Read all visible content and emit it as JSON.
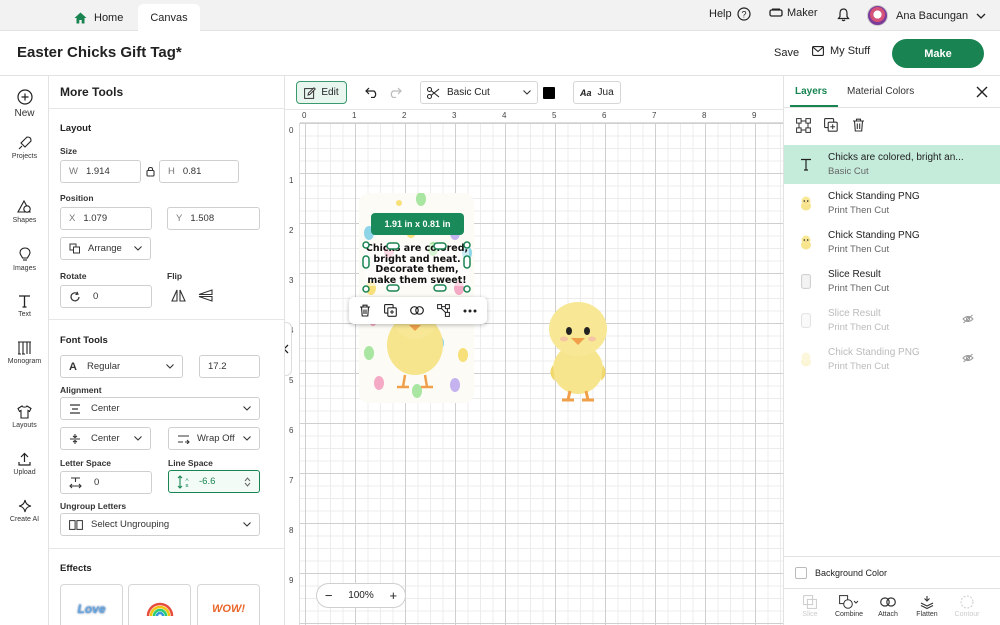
{
  "topbar": {
    "home_label": "Home",
    "canvas_label": "Canvas",
    "help_label": "Help",
    "maker_label": "Maker",
    "user_name": "Ana Bacungan"
  },
  "titlebar": {
    "project_title": "Easter Chicks Gift Tag*",
    "save_label": "Save",
    "mystuff_label": "My Stuff",
    "make_label": "Make"
  },
  "rail": {
    "new": "New",
    "projects": "Projects",
    "shapes": "Shapes",
    "images": "Images",
    "text": "Text",
    "monogram": "Monogram",
    "layouts": "Layouts",
    "upload": "Upload",
    "create_ai": "Create AI"
  },
  "tools": {
    "header": "More Tools",
    "layout": "Layout",
    "size": "Size",
    "w_prefix": "W",
    "w_value": "1.914",
    "h_prefix": "H",
    "h_value": "0.81",
    "position": "Position",
    "x_prefix": "X",
    "x_value": "1.079",
    "y_prefix": "Y",
    "y_value": "1.508",
    "arrange": "Arrange",
    "rotate": "Rotate",
    "rotate_value": "0",
    "flip": "Flip",
    "font_tools": "Font Tools",
    "font_style": "Regular",
    "font_size": "17.2",
    "alignment": "Alignment",
    "align_value": "Center",
    "valign_value": "Center",
    "wrap_value": "Wrap Off",
    "letter_space": "Letter Space",
    "letter_space_value": "0",
    "line_space": "Line Space",
    "line_space_value": "-6.6",
    "ungroup_letters": "Ungroup Letters",
    "ungroup_value": "Select Ungrouping",
    "effects": "Effects",
    "effect_1": "Love",
    "effect_3": "WOW!"
  },
  "canvas": {
    "edit_label": "Edit",
    "cut_type": "Basic Cut",
    "font_name": "Jua",
    "font_icon_text": "Aa",
    "ruler_top": [
      "0",
      "1",
      "2",
      "3",
      "4",
      "5",
      "6",
      "7",
      "8",
      "9"
    ],
    "ruler_left": [
      "0",
      "1",
      "2",
      "3",
      "4",
      "5",
      "6",
      "7",
      "8",
      "9"
    ],
    "size_badge": "1.91  in x 0.81  in",
    "text_lines": [
      "Chicks are colored,",
      "bright and neat.",
      "Decorate them,",
      "make them sweet!"
    ],
    "zoom": "100%",
    "colors": {
      "accent": "#198452",
      "tag_text": "#111111"
    }
  },
  "layers": {
    "tab_layers": "Layers",
    "tab_material": "Material Colors",
    "items": [
      {
        "name": "Chicks are colored, bright an...",
        "sub": "Basic Cut"
      },
      {
        "name": "Chick Standing PNG",
        "sub": "Print Then Cut"
      },
      {
        "name": "Chick Standing PNG",
        "sub": "Print Then Cut"
      },
      {
        "name": "Slice Result",
        "sub": "Print Then Cut"
      },
      {
        "name": "Slice Result",
        "sub": "Print Then Cut"
      },
      {
        "name": "Chick Standing PNG",
        "sub": "Print Then Cut"
      }
    ],
    "background_color": "Background Color",
    "bottom": {
      "slice": "Slice",
      "combine": "Combine",
      "attach": "Attach",
      "flatten": "Flatten",
      "contour": "Contour"
    }
  }
}
